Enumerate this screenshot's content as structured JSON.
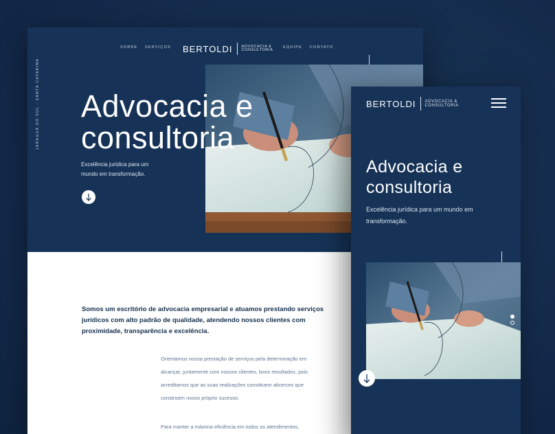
{
  "desktop": {
    "nav": {
      "left": [
        "SOBRE",
        "SERVIÇOS"
      ],
      "right": [
        "EQUIPE",
        "CONTATO"
      ]
    },
    "logo": {
      "word": "BERTOLDI",
      "sub1": "ADVOCACIA &",
      "sub2": "CONSULTORIA"
    },
    "side_text": "JARAGUÁ DO SUL - SANTA CATARINA",
    "hero": {
      "title1": "Advocacia e",
      "title2": "consultoria",
      "subtitle1": "Excelência jurídica para um",
      "subtitle2": "mundo em transformação."
    },
    "lead": "Somos um escritório de advocacia empresarial e atuamos prestando serviços jurídicos com alto padrão de qualidade, atendendo nossos clientes com proximidade, transparência e excelência.",
    "paragraph1": "Orientamos nossa prestação de serviços pela determinação em alcançar, juntamente com nossos clientes, bons resultados, pois acreditamos que as suas realizações constituem alicerces que constroem nosso próprio sucesso.",
    "paragraph2": "Para manter a máxima eficiência em todos os atendimentos,"
  },
  "mobile": {
    "logo": {
      "word": "BERTOLDI",
      "sub1": "ADVOCACIA &",
      "sub2": "CONSULTORIA"
    },
    "hero": {
      "title1": "Advocacia e",
      "title2": "consultoria",
      "subtitle": "Excelência jurídica para um mundo em transformação."
    },
    "carousel": {
      "active_index": 0,
      "count": 2
    }
  },
  "icons": {
    "down": "arrow-down-icon",
    "menu": "hamburger-menu-icon"
  },
  "colors": {
    "navy": "#163357",
    "background": "#15304d",
    "white": "#ffffff",
    "body_text": "#5f7591"
  }
}
